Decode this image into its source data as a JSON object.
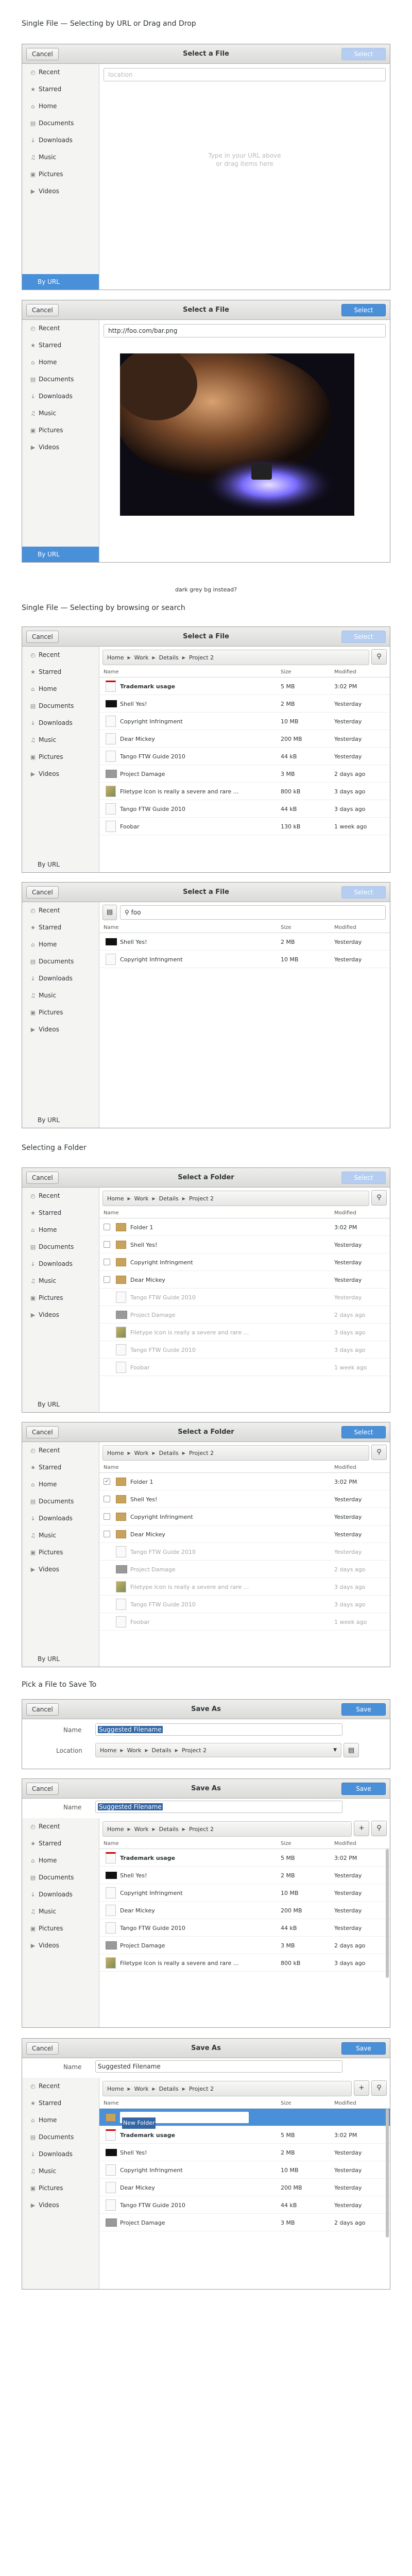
{
  "headings": {
    "h1": "Single File — Selecting by URL or Drag and Drop",
    "h2": "Single File — Selecting by browsing or search",
    "h3": "Selecting a Folder",
    "h4": "Pick a File to Save To"
  },
  "common": {
    "cancel": "Cancel",
    "select": "Select",
    "by_url": "By URL",
    "save": "Save",
    "name_label": "Name",
    "location_label": "Location",
    "size_col": "Size",
    "modified_col": "Modified",
    "name_col": "Name"
  },
  "sidebar": [
    "Recent",
    "Starred",
    "Home",
    "Documents",
    "Downloads",
    "Music",
    "Pictures",
    "Videos"
  ],
  "titles": {
    "select_file": "Select a File",
    "select_folder": "Select a Folder",
    "save_as": "Save As"
  },
  "url_placeholder": "location",
  "drop_hint": [
    "Type in your URL above",
    "or drag items here"
  ],
  "url_value": "http://foo.com/bar.png",
  "preview_caption": "dark grey bg instead?",
  "breadcrumb": [
    "Home",
    "Work",
    "Details",
    "Project 2"
  ],
  "search_value": "foo",
  "filename": "Suggested Filename",
  "new_folder": "New Folder",
  "files": [
    {
      "name": "Trademark usage",
      "size": "5 MB",
      "mod": "3:02 PM"
    },
    {
      "name": "Shell Yes!",
      "size": "2 MB",
      "mod": "Yesterday"
    },
    {
      "name": "Copyright Infringment",
      "size": "10 MB",
      "mod": "Yesterday"
    },
    {
      "name": "Dear Mickey",
      "size": "200 MB",
      "mod": "Yesterday"
    },
    {
      "name": "Tango FTW Guide 2010",
      "size": "44 kB",
      "mod": "Yesterday"
    },
    {
      "name": "Project Damage",
      "size": "3 MB",
      "mod": "2 days ago"
    },
    {
      "name": "Filetype Icon is really a severe and rare ...",
      "size": "800 kB",
      "mod": "3 days ago"
    },
    {
      "name": "Tango FTW Guide 2010",
      "size": "44 kB",
      "mod": "3 days ago"
    },
    {
      "name": "Foobar",
      "size": "130 kB",
      "mod": "1 week ago"
    }
  ],
  "search_results": [
    {
      "name": "Shell Yes!",
      "size": "2 MB",
      "mod": "Yesterday"
    },
    {
      "name": "Copyright Infringment",
      "size": "10 MB",
      "mod": "Yesterday"
    }
  ],
  "folders": [
    {
      "name": "Folder 1",
      "mod": "3:02 PM"
    },
    {
      "name": "Shell Yes!",
      "mod": "Yesterday"
    },
    {
      "name": "Copyright Infringment",
      "mod": "Yesterday"
    },
    {
      "name": "Dear Mickey",
      "mod": "Yesterday"
    },
    {
      "name": "Tango FTW Guide 2010",
      "mod": "Yesterday"
    },
    {
      "name": "Project Damage",
      "mod": "2 days ago"
    },
    {
      "name": "Filetype Icon is really a severe and rare ...",
      "mod": "3 days ago"
    },
    {
      "name": "Tango FTW Guide 2010",
      "mod": "3 days ago"
    },
    {
      "name": "Foobar",
      "mod": "1 week ago"
    }
  ]
}
